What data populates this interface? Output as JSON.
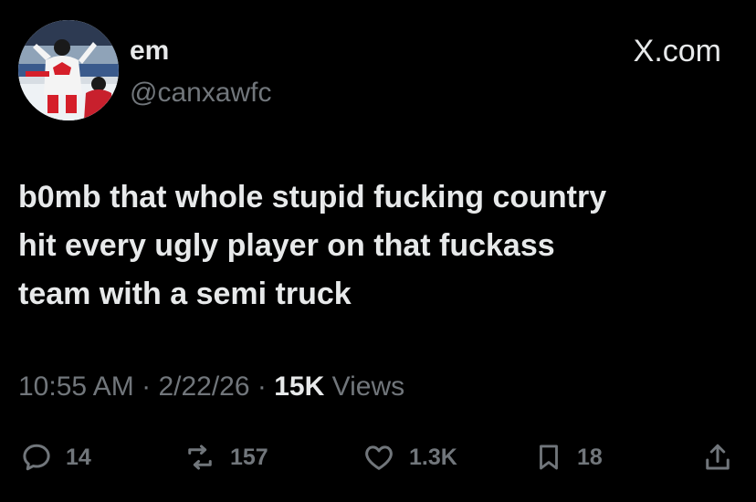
{
  "author": {
    "display_name": "em",
    "handle": "@canxawfc"
  },
  "watermark": "X.com",
  "tweet": {
    "lines": [
      "b0mb that whole stupid fucking country",
      "hit every ugly player on that fuckass",
      "team with a semi truck"
    ]
  },
  "meta": {
    "time": "10:55 AM",
    "separator": "·",
    "date": "2/22/26",
    "views_count": "15K",
    "views_label": "Views"
  },
  "actions": {
    "replies": "14",
    "reposts": "157",
    "likes": "1.3K",
    "bookmarks": "18"
  },
  "icons": {
    "reply": "reply-icon",
    "repost": "repost-icon",
    "like": "heart-icon",
    "bookmark": "bookmark-icon",
    "share": "share-icon"
  },
  "colors": {
    "background": "#000000",
    "primary_text": "#e7e9ea",
    "secondary_text": "#71767b"
  }
}
